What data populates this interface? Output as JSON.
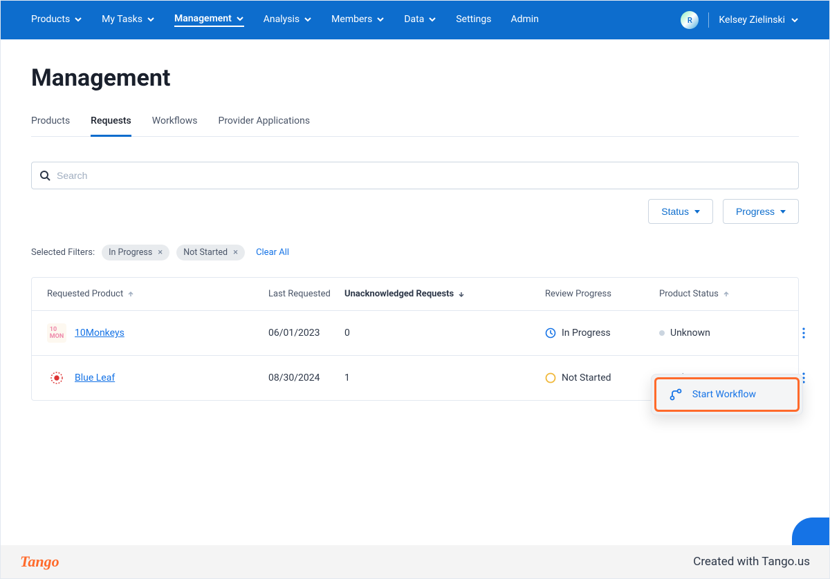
{
  "nav": {
    "items": [
      {
        "label": "Products",
        "caret": true
      },
      {
        "label": "My Tasks",
        "caret": true
      },
      {
        "label": "Management",
        "caret": true,
        "active": true
      },
      {
        "label": "Analysis",
        "caret": true
      },
      {
        "label": "Members",
        "caret": true
      },
      {
        "label": "Data",
        "caret": true
      },
      {
        "label": "Settings",
        "caret": false
      },
      {
        "label": "Admin",
        "caret": false
      }
    ],
    "user_name": "Kelsey Zielinski",
    "avatar_letter": "R"
  },
  "page": {
    "title": "Management"
  },
  "tabs": [
    {
      "label": "Products"
    },
    {
      "label": "Requests",
      "active": true
    },
    {
      "label": "Workflows"
    },
    {
      "label": "Provider Applications"
    }
  ],
  "search": {
    "placeholder": "Search"
  },
  "filter_buttons": [
    {
      "label": "Status"
    },
    {
      "label": "Progress"
    }
  ],
  "filters": {
    "label": "Selected Filters:",
    "chips": [
      {
        "label": "In Progress"
      },
      {
        "label": "Not Started"
      }
    ],
    "clear": "Clear All"
  },
  "table": {
    "columns": [
      {
        "label": "Requested Product",
        "sort": "asc"
      },
      {
        "label": "Last Requested"
      },
      {
        "label": "Unacknowledged Requests",
        "sort": "desc",
        "bold": true
      },
      {
        "label": "Review Progress"
      },
      {
        "label": "Product Status",
        "sort": "asc"
      },
      {
        "label": ""
      }
    ],
    "rows": [
      {
        "product": "10Monkeys",
        "icon": "monkeys",
        "last_requested": "06/01/2023",
        "unack": "0",
        "progress": "In Progress",
        "progress_icon": "clock",
        "status": "Unknown"
      },
      {
        "product": "Blue Leaf",
        "icon": "blueleaf",
        "last_requested": "08/30/2024",
        "unack": "1",
        "progress": "Not Started",
        "progress_icon": "circle",
        "status": "Unknown"
      }
    ]
  },
  "popover": {
    "label": "Start Workflow"
  },
  "footer": {
    "brand": "Tango",
    "text": "Created with Tango.us"
  }
}
